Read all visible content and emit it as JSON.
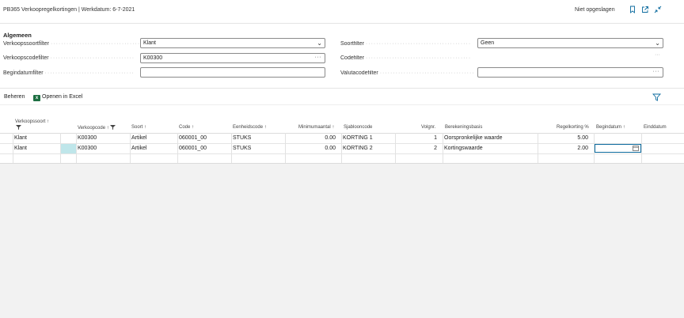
{
  "header": {
    "title": "PB365 Verkoopregelkortingen | Werkdatum: 6-7-2021",
    "save_status": "Niet opgeslagen"
  },
  "general": {
    "section_title": "Algemeen",
    "fields": {
      "sales_type_filter": {
        "label": "Verkoopssoortfilter",
        "value": "Klant"
      },
      "sales_code_filter": {
        "label": "Verkoopscodefilter",
        "value": "K00300"
      },
      "start_date_filter": {
        "label": "Begindatumfilter",
        "value": ""
      },
      "type_filter": {
        "label": "Soortfilter",
        "value": "Geen"
      },
      "code_filter": {
        "label": "Codefilter",
        "value": ""
      },
      "currency_filter": {
        "label": "Valutacodefilter",
        "value": ""
      }
    }
  },
  "actions": {
    "manage": "Beheren",
    "open_excel": "Openen in Excel"
  },
  "grid": {
    "columns": [
      "Verkoopssoort",
      "Verkoopcode",
      "Soort",
      "Code",
      "Eenheidscode",
      "Minimumaantal",
      "Sjablooncode",
      "Volgnr.",
      "Berekeningsbasis",
      "Regelkorting %",
      "Begindatum",
      "Einddatum"
    ],
    "rows": [
      {
        "sales_type": "Klant",
        "sales_code": "K00300",
        "type": "Artikel",
        "code": "060001_00",
        "unit": "STUKS",
        "min_qty": "0.00",
        "template": "KORTING 1",
        "seq": "1",
        "basis": "Oorspronkelijke waarde",
        "discount": "5.00",
        "start_date": "",
        "end_date": ""
      },
      {
        "sales_type": "Klant",
        "sales_code": "K00300",
        "type": "Artikel",
        "code": "060001_00",
        "unit": "STUKS",
        "min_qty": "0.00",
        "template": "KORTING 2",
        "seq": "2",
        "basis": "Kortingswaarde",
        "discount": "2.00",
        "start_date": "",
        "end_date": ""
      }
    ]
  },
  "colors": {
    "accent": "#0b6a9e",
    "selected_cell": "#bfe6ea",
    "excel": "#1d6f42"
  },
  "icons": [
    "bookmark-icon",
    "open-new-window-icon",
    "collapse-icon",
    "chevron-down-icon",
    "ellipsis-icon",
    "excel-icon",
    "filter-icon",
    "sort-up-icon",
    "funnel-icon",
    "calendar-icon"
  ]
}
